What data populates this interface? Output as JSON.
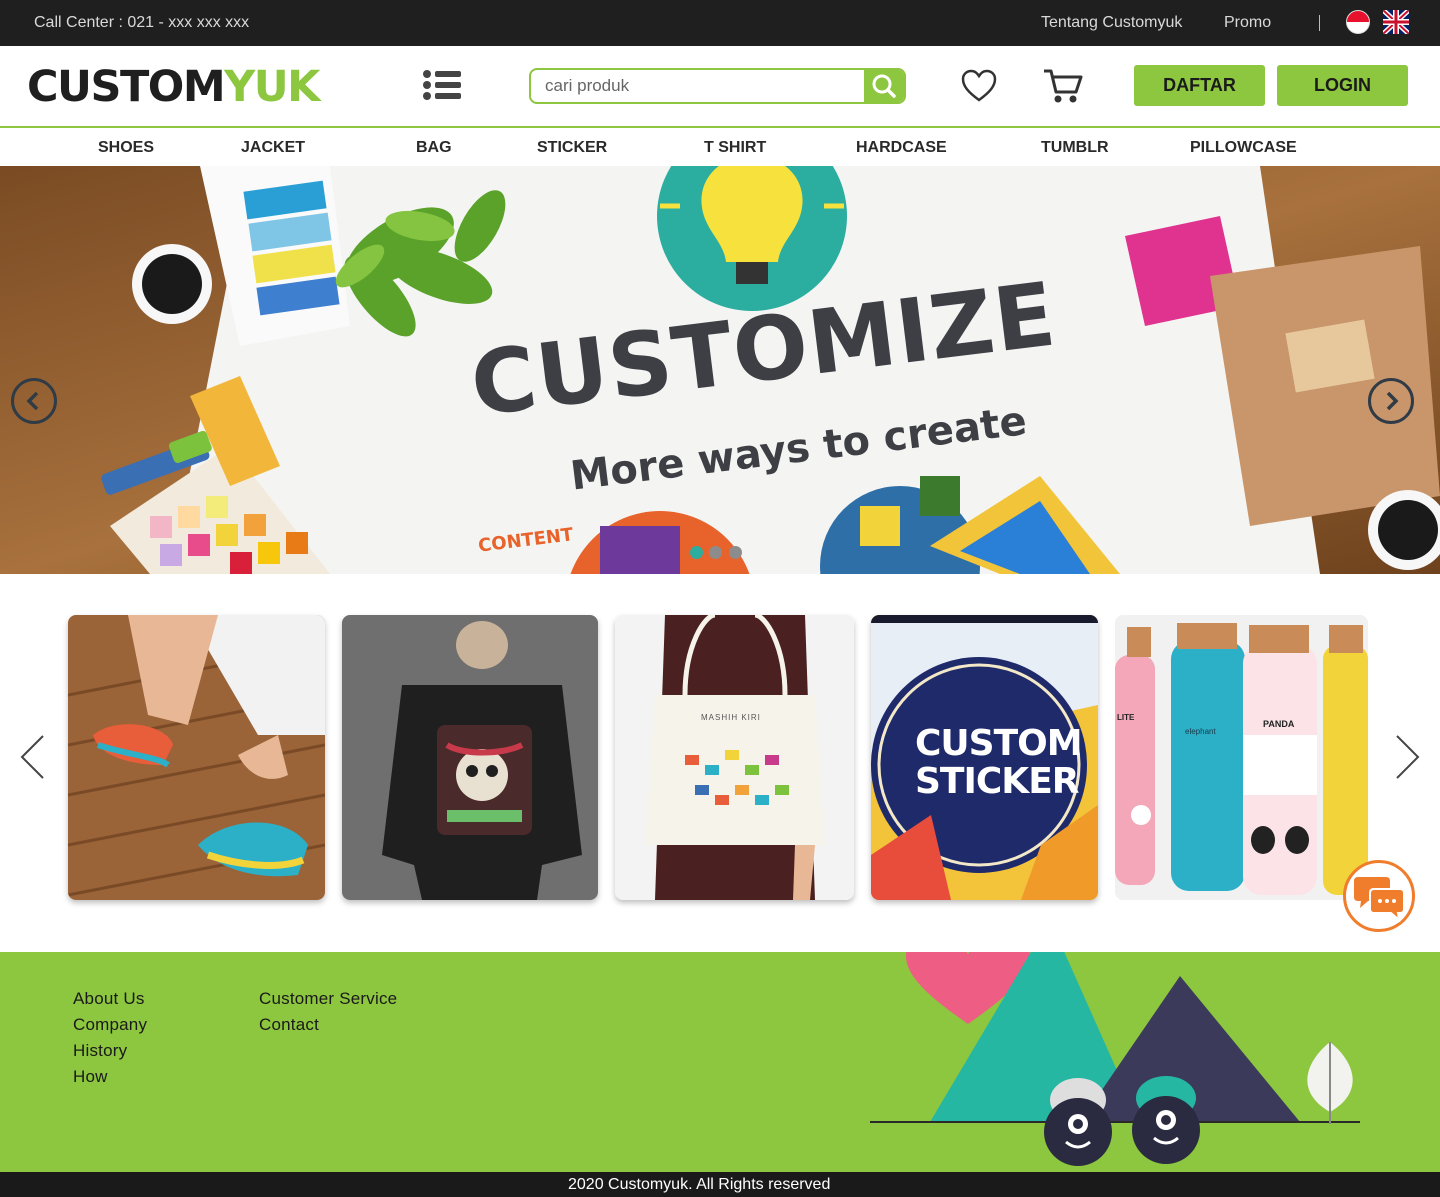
{
  "topbar": {
    "call_center": "Call Center :  021 - xxx xxx xxx",
    "links": [
      "Tentang Customyuk",
      "Promo"
    ]
  },
  "header": {
    "logo_part1": "CUSTOM",
    "logo_part2": "YUK",
    "search_placeholder": "cari produk",
    "buttons": {
      "daftar": "DAFTAR",
      "login": "LOGIN"
    }
  },
  "categories": [
    "SHOES",
    "JACKET",
    "BAG",
    "STICKER",
    "T SHIRT",
    "HARDCASE",
    "TUMBLR",
    "PILLOWCASE"
  ],
  "hero": {
    "title": "CUSTOMIZE",
    "subtitle": "More ways to create",
    "content_label": "CONTENT",
    "slide_count": 3
  },
  "products": {
    "sticker_card_text_1": "CUSTOM",
    "sticker_card_text_2": "STICKER",
    "bag_print": "MASHIH KIRI",
    "tumbler_labels": [
      "LITE",
      "elephant",
      "PANDA"
    ]
  },
  "footer": {
    "col1": [
      "About Us",
      "Company",
      "History",
      "How"
    ],
    "col2": [
      "Customer Service",
      "Contact"
    ],
    "copyright": "2020 Customyuk. All Rights reserved"
  },
  "colors": {
    "brand_green": "#8dc63f",
    "dark": "#1f1f1f",
    "chat_orange": "#f07d2b"
  }
}
